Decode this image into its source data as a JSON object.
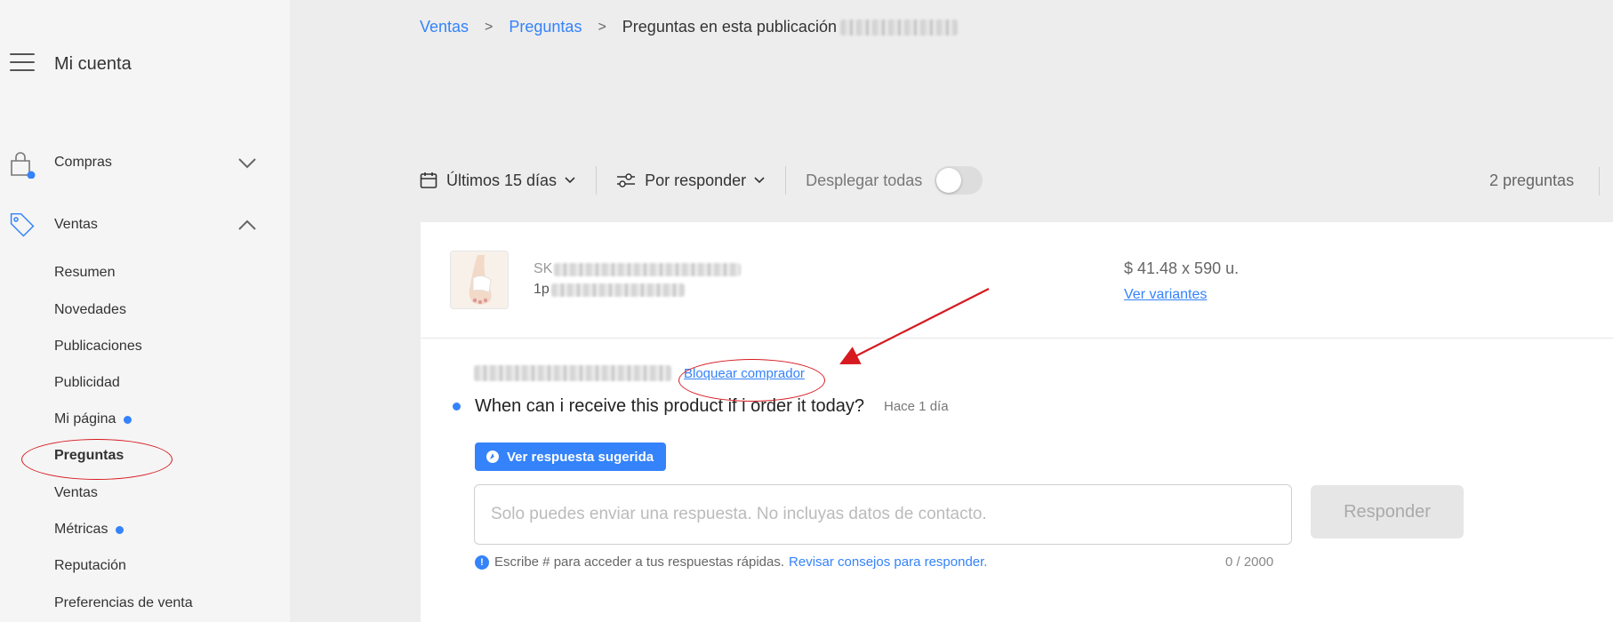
{
  "sidebar": {
    "title": "Mi cuenta",
    "sections": [
      {
        "label": "Compras"
      },
      {
        "label": "Ventas"
      }
    ],
    "items": [
      {
        "label": "Resumen"
      },
      {
        "label": "Novedades"
      },
      {
        "label": "Publicaciones"
      },
      {
        "label": "Publicidad"
      },
      {
        "label": "Mi página"
      },
      {
        "label": "Preguntas"
      },
      {
        "label": "Ventas"
      },
      {
        "label": "Métricas"
      },
      {
        "label": "Reputación"
      },
      {
        "label": "Preferencias de venta"
      }
    ]
  },
  "breadcrumb": {
    "items": [
      "Ventas",
      "Preguntas"
    ],
    "current": "Preguntas en esta publicación"
  },
  "filters": {
    "period": "Últimos 15 días",
    "status": "Por responder",
    "expand_label": "Desplegar todas",
    "count": "2 preguntas"
  },
  "product": {
    "sku_prefix": "SK",
    "id_prefix": "1p",
    "price": "$ 41.48 x 590 u.",
    "variants_link": "Ver variantes"
  },
  "question": {
    "block_link": "Bloquear comprador",
    "text": "When can i receive this product if i order it today?",
    "time": "Hace 1 día",
    "suggest_button": "Ver respuesta sugerida",
    "answer_placeholder": "Solo puedes enviar una respuesta. No incluyas datos de contacto.",
    "reply_button": "Responder",
    "hint_text": "Escribe # para acceder a tus respuestas rápidas.",
    "hint_link": "Revisar consejos para responder.",
    "char_count": "0 / 2000"
  },
  "colors": {
    "accent": "#3483fa",
    "annotation": "#d71920"
  }
}
